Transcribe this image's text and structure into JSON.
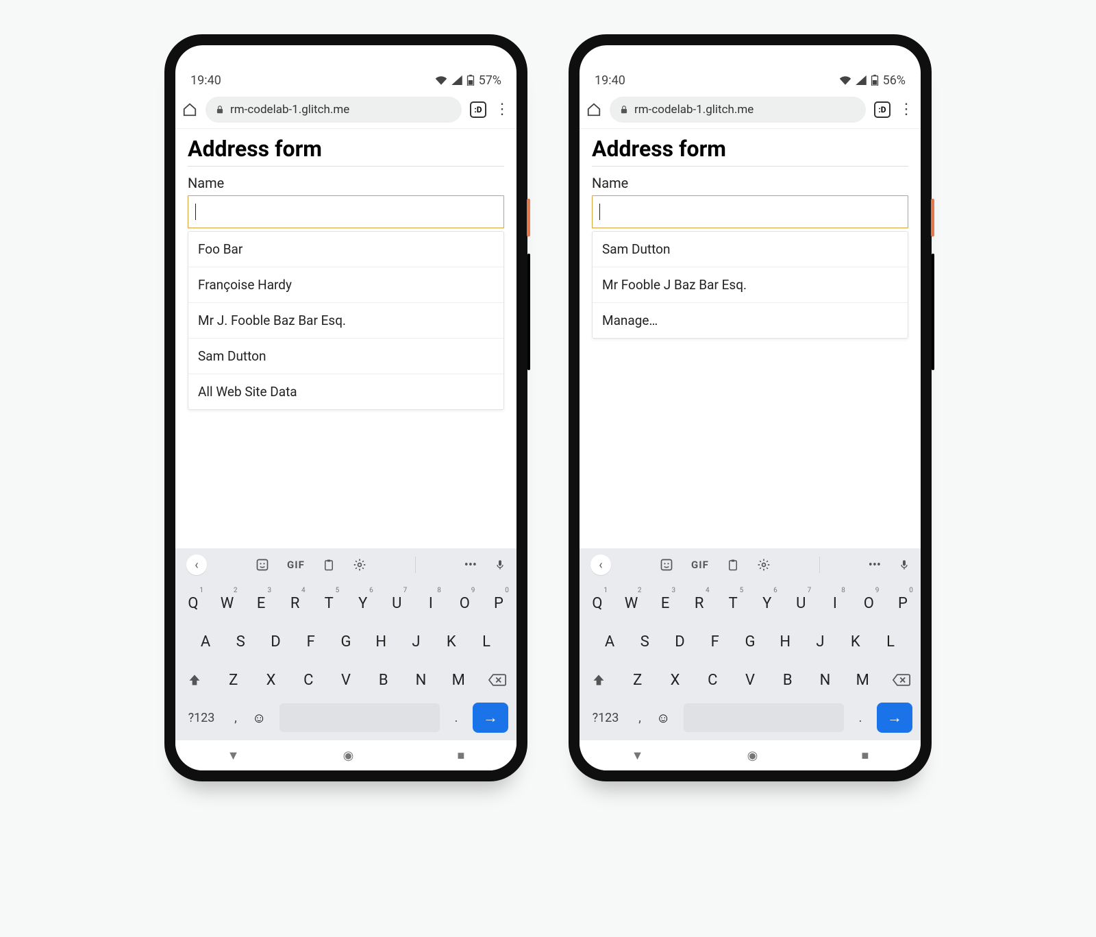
{
  "phones": [
    {
      "status": {
        "time": "19:40",
        "battery": "57%"
      },
      "url": "rm-codelab-1.glitch.me",
      "tabcount": ":D",
      "page_title": "Address form",
      "field_label": "Name",
      "field_value": "",
      "suggestions": [
        "Foo Bar",
        "Françoise Hardy",
        "Mr J. Fooble Baz Bar Esq.",
        "Sam Dutton",
        "All Web Site Data"
      ]
    },
    {
      "status": {
        "time": "19:40",
        "battery": "56%"
      },
      "url": "rm-codelab-1.glitch.me",
      "tabcount": ":D",
      "page_title": "Address form",
      "field_label": "Name",
      "field_value": "",
      "suggestions": [
        "Sam Dutton",
        "Mr Fooble J Baz Bar Esq.",
        "Manage…"
      ]
    }
  ],
  "keyboard": {
    "tool_gif": "GIF",
    "k123": "?123",
    "row1": [
      {
        "k": "Q",
        "s": "1"
      },
      {
        "k": "W",
        "s": "2"
      },
      {
        "k": "E",
        "s": "3"
      },
      {
        "k": "R",
        "s": "4"
      },
      {
        "k": "T",
        "s": "5"
      },
      {
        "k": "Y",
        "s": "6"
      },
      {
        "k": "U",
        "s": "7"
      },
      {
        "k": "I",
        "s": "8"
      },
      {
        "k": "O",
        "s": "9"
      },
      {
        "k": "P",
        "s": "0"
      }
    ],
    "row2": [
      "A",
      "S",
      "D",
      "F",
      "G",
      "H",
      "J",
      "K",
      "L"
    ],
    "row3": [
      "Z",
      "X",
      "C",
      "V",
      "B",
      "N",
      "M"
    ],
    "comma": ",",
    "period": "."
  }
}
